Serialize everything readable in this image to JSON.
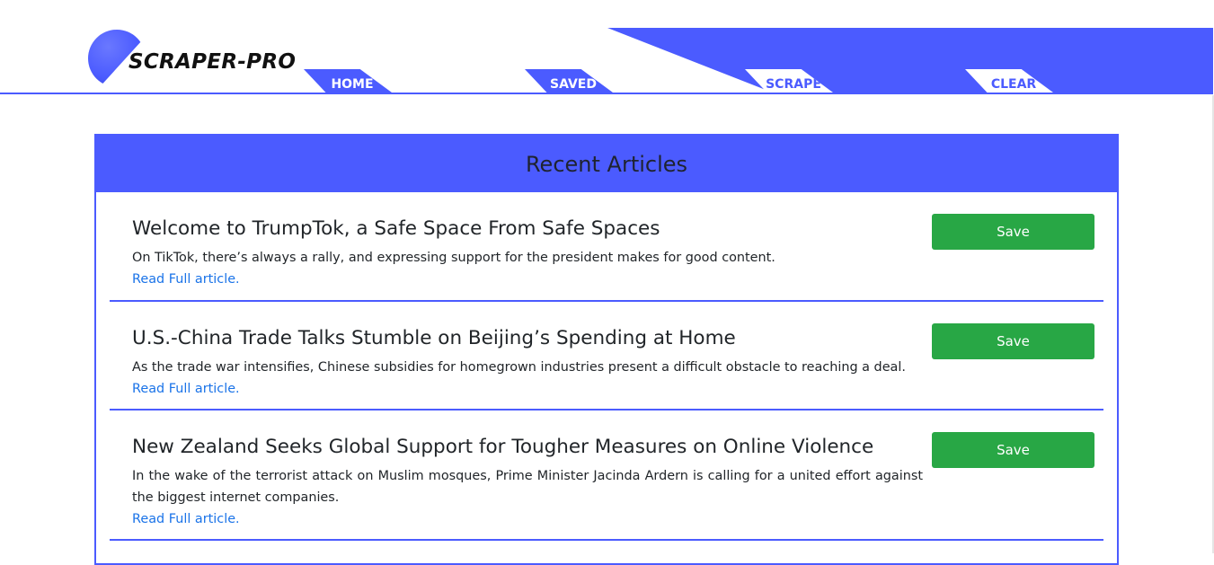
{
  "header": {
    "brand": "SCRAPER-PRO",
    "nav": [
      {
        "label": "HOME"
      },
      {
        "label": "SAVED"
      },
      {
        "label": "SCRAPE"
      },
      {
        "label": "CLEAR"
      }
    ]
  },
  "main": {
    "panel_title": "Recent Articles",
    "articles": [
      {
        "title": "Welcome to TrumpTok, a Safe Space From Safe Spaces",
        "summary": "On TikTok, there’s always a rally, and expressing support for the president makes for good content.",
        "link_label": "Read Full article.",
        "save_label": "Save"
      },
      {
        "title": "U.S.-China Trade Talks Stumble on Beijing’s Spending at Home",
        "summary": "As the trade war intensifies, Chinese subsidies for homegrown industries present a difficult obstacle to reaching a deal.",
        "link_label": "Read Full article.",
        "save_label": "Save"
      },
      {
        "title": "New Zealand Seeks Global Support for Tougher Measures on Online Violence",
        "summary": "In the wake of the terrorist attack on Muslim mosques, Prime Minister Jacinda Ardern is calling for a united effort against the biggest internet companies.",
        "link_label": "Read Full article.",
        "save_label": "Save"
      }
    ]
  },
  "colors": {
    "accent": "#4b5bff",
    "save_button": "#28a745",
    "link": "#1a73e8",
    "text": "#212529"
  },
  "icons": {
    "logo": "sphere-logo-icon"
  }
}
